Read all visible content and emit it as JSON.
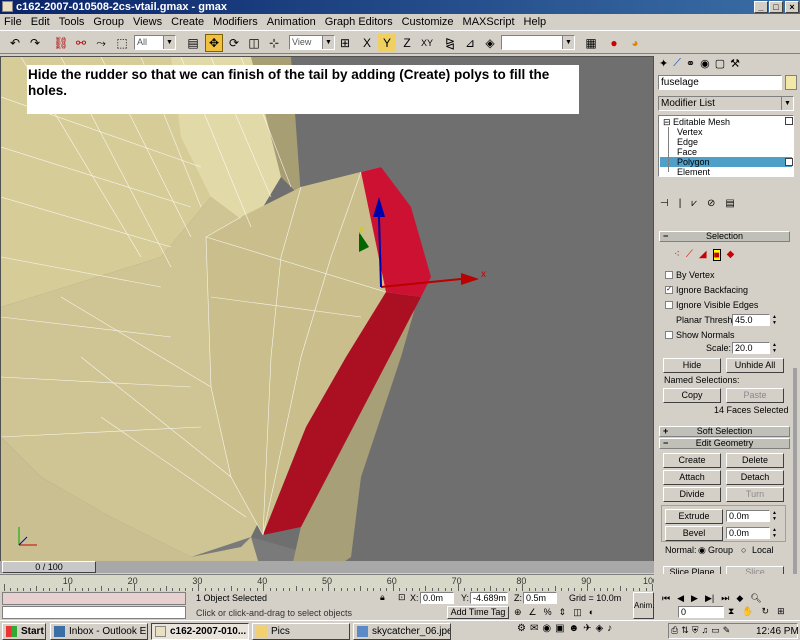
{
  "window": {
    "title": "c162-2007-010508-2cs-vtail.gmax - gmax",
    "buttons": {
      "minimize": "_",
      "maximize": "□",
      "close": "×"
    }
  },
  "menu": [
    "File",
    "Edit",
    "Tools",
    "Group",
    "Views",
    "Create",
    "Modifiers",
    "Animation",
    "Graph Editors",
    "Customize",
    "MAXScript",
    "Help"
  ],
  "toolbar": {
    "selection_filter": "All",
    "reference_coord": "View",
    "named_selection_sets": "",
    "icons": [
      "undo-icon",
      "redo-icon",
      "link-icon",
      "unlink-icon",
      "bind-icon",
      "select-icon",
      "region-select-icon",
      "move-icon",
      "rotate-icon",
      "scale-icon",
      "pivot-icon",
      "mirror-icon",
      "align-icon",
      "snap-icon",
      "angle-snap-icon",
      "percent-snap-icon",
      "material-icon",
      "render-icon"
    ]
  },
  "viewport": {
    "instruction": "Hide the rudder so that we can finish of the tail by adding (Create) polys to fill the holes.",
    "axis_x": "x",
    "axis_y": "y",
    "colors": {
      "background": "#7a7a7a",
      "mesh": "#d8cfa0",
      "selected": "#cc1133"
    }
  },
  "command_panel": {
    "tabs": [
      "create-tab-icon",
      "modify-tab-icon",
      "hierarchy-tab-icon",
      "motion-tab-icon",
      "display-tab-icon",
      "utilities-tab-icon"
    ],
    "object_name": "fuselage",
    "object_color": "#f4e8a8",
    "modifier_list": "Modifier List",
    "stack": {
      "root": "Editable Mesh",
      "items": [
        "Vertex",
        "Edge",
        "Face",
        "Polygon",
        "Element"
      ],
      "selected_index": 3
    },
    "selection": {
      "title": "Selection",
      "by_vertex": "By Vertex",
      "ignore_backfacing": "Ignore Backfacing",
      "ignore_visible_edges": "Ignore Visible Edges",
      "planar_thresh_label": "Planar Thresh:",
      "planar_thresh_value": "45.0",
      "show_normals": "Show Normals",
      "scale_label": "Scale:",
      "scale_value": "20.0",
      "hide": "Hide",
      "unhide_all": "Unhide All",
      "named_selections": "Named Selections:",
      "copy": "Copy",
      "paste": "Paste",
      "summary": "14 Faces Selected",
      "checks": {
        "by_vertex": false,
        "ignore_backfacing": true,
        "ignore_visible_edges": false,
        "show_normals": false
      }
    },
    "soft_selection": {
      "title": "Soft Selection"
    },
    "edit_geometry": {
      "title": "Edit Geometry",
      "create": "Create",
      "delete": "Delete",
      "attach": "Attach",
      "detach": "Detach",
      "divide": "Divide",
      "turn": "Turn",
      "extrude": "Extrude",
      "extrude_value": "0.0m",
      "bevel": "Bevel",
      "bevel_value": "0.0m",
      "normal_label": "Normal:",
      "group": "Group",
      "local": "Local",
      "slice_plane": "Slice Plane",
      "slice": "Slice"
    }
  },
  "timeline": {
    "frame_display": "0 / 100",
    "ticks": [
      "10",
      "20",
      "30",
      "40",
      "50",
      "60",
      "70",
      "80",
      "90",
      "100"
    ]
  },
  "status": {
    "selected": "1 Object Selected",
    "prompt": "Click or click-and-drag to select objects",
    "x_label": "X:",
    "x_value": "0.0m",
    "y_label": "Y:",
    "y_value": "-4.689m",
    "z_label": "Z:",
    "z_value": "0.5m",
    "grid": "Grid = 10.0m",
    "add_time_tag": "Add Time Tag",
    "anim": "Anim.",
    "current_frame": "0"
  },
  "taskbar": {
    "start": "Start",
    "tasks": [
      "Inbox - Outlook E...",
      "c162-2007-010...",
      "Pics",
      "skycatcher_06.jpe..."
    ],
    "active_index": 1,
    "clock": "12:46 PM"
  }
}
